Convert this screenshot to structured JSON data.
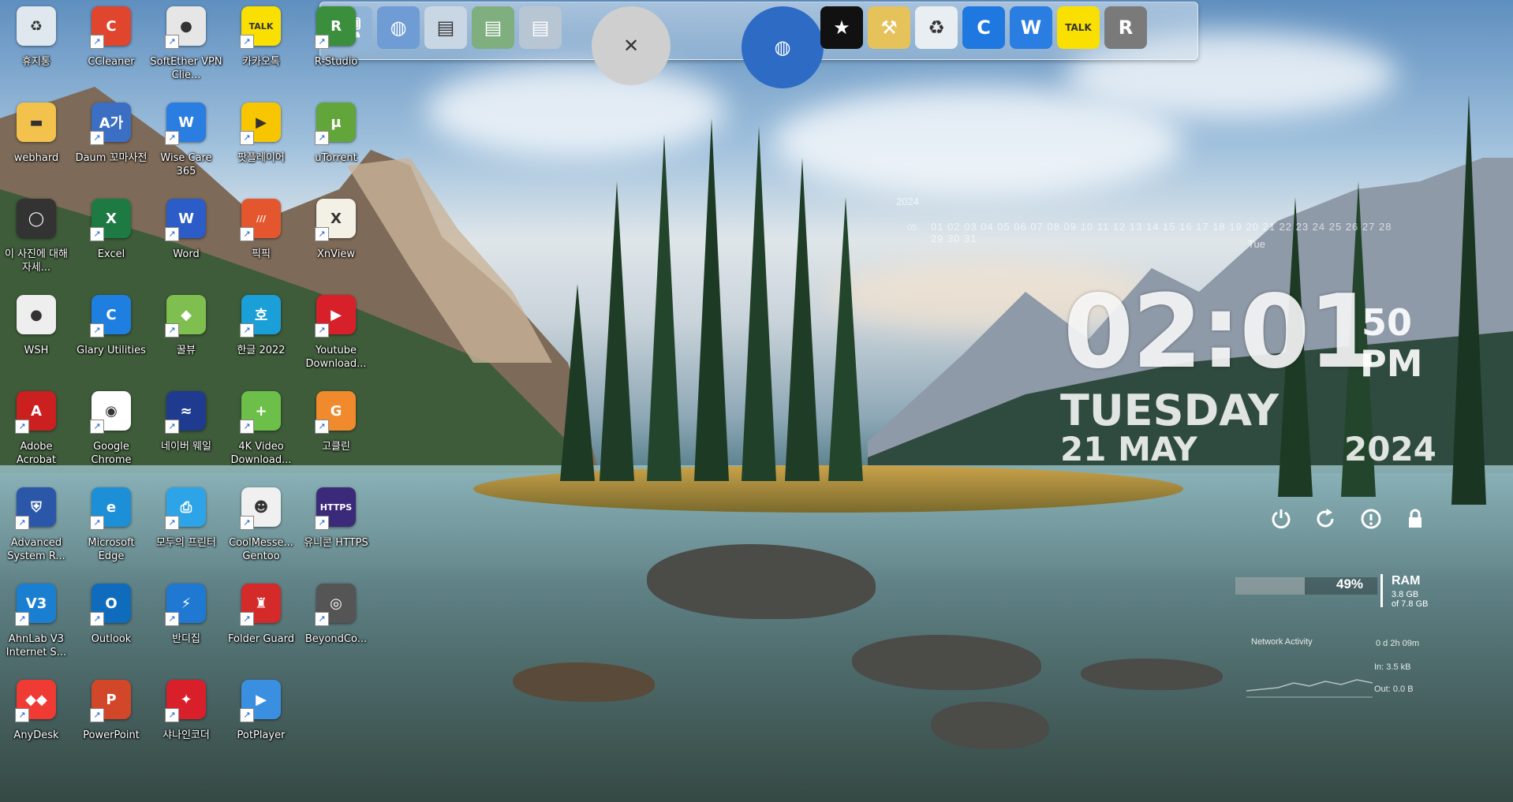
{
  "desktop": {
    "icons": [
      {
        "label": "휴지통",
        "icon": "recycle-bin-icon",
        "color": "#dfe8ee",
        "glyph": "♻"
      },
      {
        "label": "CCleaner",
        "icon": "ccleaner-icon",
        "color": "#e0452d",
        "glyph": "C"
      },
      {
        "label": "SoftEther VPN Clie...",
        "icon": "softether-vpn-icon",
        "color": "#e6e6e6",
        "glyph": "●"
      },
      {
        "label": "카카오톡",
        "icon": "kakaotalk-icon",
        "color": "#f9e000",
        "glyph": "TALK"
      },
      {
        "label": "R-Studio",
        "icon": "r-studio-icon",
        "color": "#3b8f3c",
        "glyph": "R"
      },
      {
        "label": "webhard",
        "icon": "folder-icon",
        "color": "#f2c24c",
        "glyph": "▬"
      },
      {
        "label": "Daum 꼬마사전",
        "icon": "dictionary-icon",
        "color": "#3b6fc4",
        "glyph": "A가"
      },
      {
        "label": "Wise Care 365",
        "icon": "wise-care-icon",
        "color": "#2a7de1",
        "glyph": "W"
      },
      {
        "label": "팟플레이어",
        "icon": "potplayer-yellow-icon",
        "color": "#f7c600",
        "glyph": "▶"
      },
      {
        "label": "uTorrent",
        "icon": "utorrent-icon",
        "color": "#62a53a",
        "glyph": "µ"
      },
      {
        "label": "이 사진에 대해 자세...",
        "icon": "info-circle-icon",
        "color": "#333333",
        "glyph": "◯"
      },
      {
        "label": "Excel",
        "icon": "excel-icon",
        "color": "#1d7a43",
        "glyph": "X"
      },
      {
        "label": "Word",
        "icon": "word-icon",
        "color": "#2b5cc7",
        "glyph": "W"
      },
      {
        "label": "픽픽",
        "icon": "picpick-icon",
        "color": "#e4572e",
        "glyph": "///"
      },
      {
        "label": "XnView",
        "icon": "xnview-icon",
        "color": "#f3f0e6",
        "glyph": "X"
      },
      {
        "label": "WSH",
        "icon": "file-icon",
        "color": "#eeeeee",
        "glyph": "●"
      },
      {
        "label": "Glary Utilities",
        "icon": "glary-utilities-icon",
        "color": "#1f7fe0",
        "glyph": "C"
      },
      {
        "label": "꿀뷰",
        "icon": "honeyview-icon",
        "color": "#7fbf4f",
        "glyph": "◆"
      },
      {
        "label": "한글 2022",
        "icon": "hangul-icon",
        "color": "#1a9fd8",
        "glyph": "호"
      },
      {
        "label": "Youtube Download...",
        "icon": "youtube-downloader-icon",
        "color": "#d8202a",
        "glyph": "▶"
      },
      {
        "label": "Adobe Acrobat",
        "icon": "acrobat-icon",
        "color": "#cc1f1f",
        "glyph": "A"
      },
      {
        "label": "Google Chrome",
        "icon": "chrome-icon",
        "color": "#ffffff",
        "glyph": "◉"
      },
      {
        "label": "네이버 웨일",
        "icon": "whale-icon",
        "color": "#1e3b8f",
        "glyph": "≈"
      },
      {
        "label": "4K Video Download...",
        "icon": "4k-downloader-icon",
        "color": "#6cc04a",
        "glyph": "+"
      },
      {
        "label": "고클린",
        "icon": "goclean-icon",
        "color": "#f08a2c",
        "glyph": "G"
      },
      {
        "label": "Advanced System R...",
        "icon": "advanced-system-repair-icon",
        "color": "#2a57a8",
        "glyph": "⛨"
      },
      {
        "label": "Microsoft Edge",
        "icon": "edge-icon",
        "color": "#1c8fd6",
        "glyph": "e"
      },
      {
        "label": "모두의 프린터",
        "icon": "printer-icon",
        "color": "#2ea4e8",
        "glyph": "⎙"
      },
      {
        "label": "CoolMesse... Gentoo",
        "icon": "coolmessenger-icon",
        "color": "#f0f0f0",
        "glyph": "☻"
      },
      {
        "label": "유니콘 HTTPS",
        "icon": "unicorn-https-icon",
        "color": "#3b2a7a",
        "glyph": "HTTPS"
      },
      {
        "label": "AhnLab V3 Internet S...",
        "icon": "ahnlab-v3-icon",
        "color": "#1b7fd1",
        "glyph": "V3"
      },
      {
        "label": "Outlook",
        "icon": "outlook-icon",
        "color": "#0f6cbd",
        "glyph": "O"
      },
      {
        "label": "반디집",
        "icon": "bandizip-icon",
        "color": "#1f78d1",
        "glyph": "⚡"
      },
      {
        "label": "Folder Guard",
        "icon": "folder-guard-icon",
        "color": "#d42a2a",
        "glyph": "♜"
      },
      {
        "label": "BeyondCo...",
        "icon": "beyond-compare-icon",
        "color": "#555555",
        "glyph": "◎"
      },
      {
        "label": "AnyDesk",
        "icon": "anydesk-icon",
        "color": "#ef3b33",
        "glyph": "◆◆"
      },
      {
        "label": "PowerPoint",
        "icon": "powerpoint-icon",
        "color": "#d2472a",
        "glyph": "P"
      },
      {
        "label": "샤나인코더",
        "icon": "shana-encoder-icon",
        "color": "#d81f2a",
        "glyph": "✦"
      },
      {
        "label": "PotPlayer",
        "icon": "potplayer-icon",
        "color": "#3b8fe0",
        "glyph": "▶"
      }
    ]
  },
  "dock": {
    "items": [
      {
        "icon": "computer-icon",
        "glyph": "🖥"
      },
      {
        "icon": "network-globe-icon",
        "glyph": "◍"
      },
      {
        "icon": "documents-folder-icon",
        "glyph": "▤"
      },
      {
        "icon": "green-folder-icon",
        "glyph": "▤"
      },
      {
        "icon": "pictures-folder-icon",
        "glyph": "▤"
      },
      {
        "icon": "tools-hammer-icon",
        "glyph": "✕"
      },
      {
        "icon": "globe-icon",
        "glyph": "◍"
      },
      {
        "icon": "tshirt-icon",
        "glyph": "★"
      },
      {
        "icon": "wrench-hammer-icon",
        "glyph": "⚒"
      },
      {
        "icon": "recycle-bin-icon",
        "glyph": "♻"
      },
      {
        "icon": "glary-utilities-icon",
        "glyph": "C"
      },
      {
        "icon": "wise-care-icon",
        "glyph": "W"
      },
      {
        "icon": "kakaotalk-icon",
        "glyph": "TALK"
      },
      {
        "icon": "r-studio-icon",
        "glyph": "R"
      }
    ]
  },
  "calendar": {
    "year": "2024",
    "month": "05",
    "days": "01 02 03 04 05 06 07 08 09 10 11 12 13 14 15 16 17 18 19 20 21 22 23 24 25 26 27 28 29 30 31",
    "weekday_short": "Tue"
  },
  "clock": {
    "time": "02:01",
    "seconds": "50",
    "ampm": "PM",
    "day": "TUESDAY",
    "date": "21 MAY",
    "year": "2024"
  },
  "power": [
    {
      "icon": "power-icon",
      "glyph": "⏻"
    },
    {
      "icon": "restart-icon",
      "glyph": "↻"
    },
    {
      "icon": "sleep-icon",
      "glyph": "ⓘ"
    },
    {
      "icon": "lock-icon",
      "glyph": "🔒"
    }
  ],
  "system": {
    "ram_percent": "49%",
    "ram_fill": 0.49,
    "ram_label": "RAM",
    "ram_used": "3.8 GB",
    "ram_total": "of 7.8 GB",
    "network_title": "Network Activity",
    "uptime": "0 d 2h 09m",
    "net_in": "In: 3.5 kB",
    "net_out": "Out: 0.0 B"
  }
}
